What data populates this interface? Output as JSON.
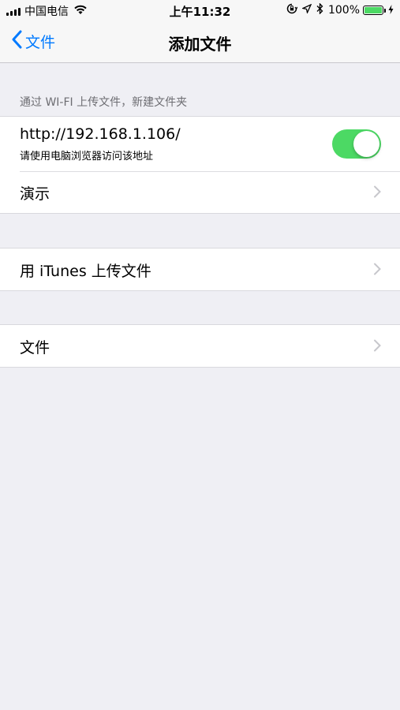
{
  "status_bar": {
    "carrier": "中国电信",
    "time": "上午11:32",
    "battery": "100%",
    "battery_level": 1.0,
    "icons": [
      "signal-icon",
      "wifi-icon",
      "orientation-lock-icon",
      "location-icon",
      "bluetooth-icon",
      "battery-icon",
      "charging-icon"
    ]
  },
  "nav": {
    "back_label": "文件",
    "title": "添加文件"
  },
  "wifi_section": {
    "header": "通过 WI-FI 上传文件，新建文件夹",
    "url_title": "http://192.168.1.106/",
    "url_subtitle": "请使用电脑浏览器访问该地址",
    "toggle_on": true,
    "demo_label": "演示"
  },
  "itunes_section": {
    "label": "用 iTunes 上传文件"
  },
  "files_section": {
    "label": "文件"
  },
  "colors": {
    "accent": "#007aff",
    "toggle_on": "#4cd964",
    "background": "#efeff4"
  }
}
